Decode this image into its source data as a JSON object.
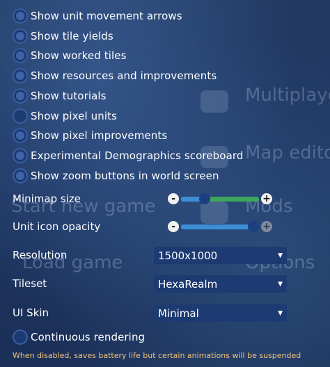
{
  "background": {
    "texts": [
      "Multiplayer",
      "Map editor",
      "Start new game",
      "Mods",
      "Load game",
      "Options"
    ]
  },
  "checkboxes": [
    {
      "label": "Show unit movement arrows",
      "checked": true
    },
    {
      "label": "Show tile yields",
      "checked": true
    },
    {
      "label": "Show worked tiles",
      "checked": true
    },
    {
      "label": "Show resources and improvements",
      "checked": true
    },
    {
      "label": "Show tutorials",
      "checked": true
    },
    {
      "label": "Show pixel units",
      "checked": false
    },
    {
      "label": "Show pixel improvements",
      "checked": true
    },
    {
      "label": "Experimental Demographics scoreboard",
      "checked": true
    },
    {
      "label": "Show zoom buttons in world screen",
      "checked": true
    }
  ],
  "minimap": {
    "label": "Minimap size",
    "value_fraction": 0.27,
    "minus": "-",
    "plus": "+"
  },
  "unit_icon_opacity": {
    "label": "Unit icon opacity",
    "value_fraction": 1.0,
    "minus": "-",
    "plus": "+"
  },
  "resolution": {
    "label": "Resolution",
    "value": "1500x1000"
  },
  "tileset": {
    "label": "Tileset",
    "value": "HexaRealm"
  },
  "ui_skin": {
    "label": "UI Skin",
    "value": "Minimal"
  },
  "continuous_rendering": {
    "label": "Continuous rendering",
    "checked": false
  },
  "note": "When disabled, saves battery life but certain animations will be suspended",
  "colors": {
    "accent": "#3f63a8",
    "slider_blue": "#3b8fd6",
    "slider_green": "#3ea65a",
    "note": "#f2c27a"
  }
}
